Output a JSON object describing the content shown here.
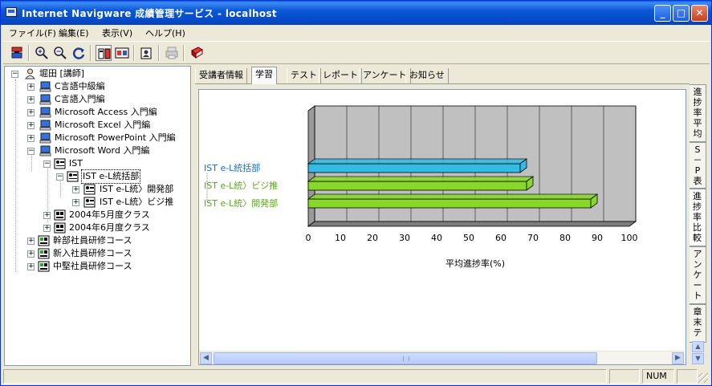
{
  "window": {
    "title": "Internet Navigware 成績管理サービス - localhost",
    "controls": {
      "minimize": "_",
      "maximize": "□",
      "close": "✕"
    }
  },
  "menu": [
    "ファイル(F)",
    "編集(E)",
    "表示(V)",
    "ヘルプ(H)"
  ],
  "toolbar": {
    "icons": [
      "switch-server-icon",
      "zoom-in-icon",
      "zoom-out-icon",
      "refresh-icon",
      "view-mode-1-icon",
      "view-mode-2-icon",
      "profile-icon",
      "print-icon",
      "book-icon"
    ]
  },
  "tree": {
    "root": "堀田 [講師]",
    "courses": [
      "C言語中級編",
      "C言語入門編",
      "Microsoft Access 入門編",
      "Microsoft Excel 入門編",
      "Microsoft PowerPoint 入門編",
      "Microsoft Word 入門編"
    ],
    "group": "IST",
    "selected": "IST e-L統括部",
    "subgroups": [
      "IST e-L統〉開発部",
      "IST e-L統〉ビジ推"
    ],
    "classes": [
      "2004年5月度クラス",
      "2004年6月度クラス"
    ],
    "other_courses": [
      "幹部社員研修コース",
      "新入社員研修コース",
      "中堅社員研修コース"
    ]
  },
  "tabs": [
    "受講者情報",
    "学習",
    "テスト",
    "レポート",
    "アンケート",
    "お知らせ"
  ],
  "active_tab": "学習",
  "side_tabs": [
    "進捗率平均",
    "S－P表",
    "進捗率比較",
    "アンケート",
    "章末テ"
  ],
  "active_side_tab": "進捗率比較",
  "chart_data": {
    "type": "bar",
    "orientation": "horizontal",
    "categories": [
      "IST e-L統括部",
      "IST e-L統〉ビジ推",
      "IST e-L統〉開発部"
    ],
    "values": [
      66,
      68,
      88
    ],
    "colors": [
      "#33bbe6",
      "#88d82a",
      "#88d82a"
    ],
    "label_colors": [
      "#1a6fc4",
      "#5aa81a",
      "#5aa81a"
    ],
    "xlabel": "平均進捗率(%)",
    "xlim": [
      0,
      100
    ],
    "xticks": [
      "0",
      "10",
      "20",
      "30",
      "40",
      "50",
      "60",
      "70",
      "80",
      "90",
      "100"
    ],
    "grid": true
  },
  "statusbar": {
    "num": "NUM"
  },
  "scroll": {
    "left": "◀",
    "right": "▶",
    "up": "▲",
    "down": "▼"
  }
}
